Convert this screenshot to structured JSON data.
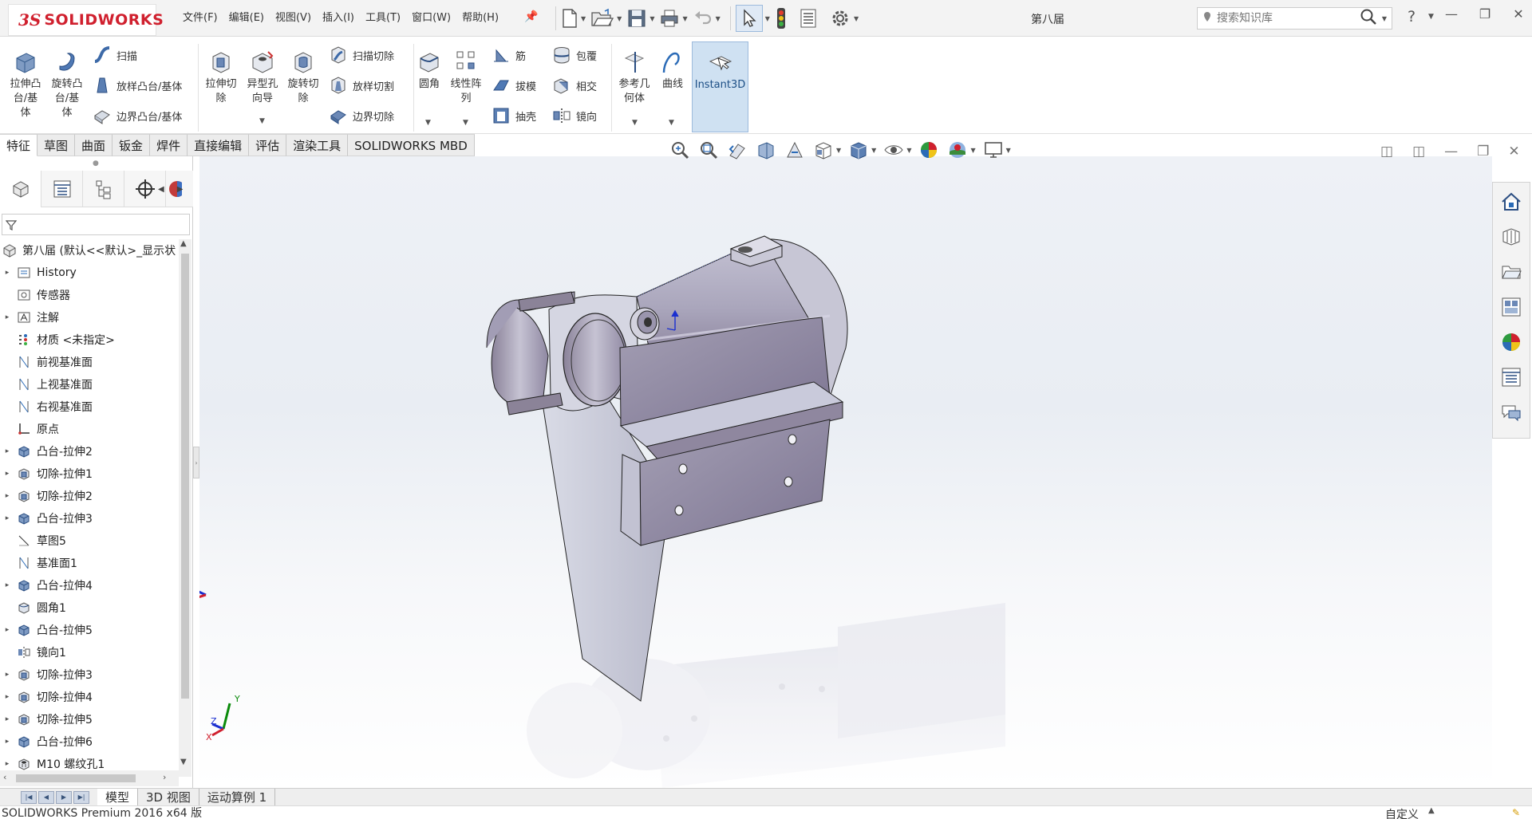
{
  "app": {
    "logo_ds": "3S",
    "logo_text": "SOLIDWORKS",
    "document_title": "第八届"
  },
  "menus": [
    "文件(F)",
    "编辑(E)",
    "视图(V)",
    "插入(I)",
    "工具(T)",
    "窗口(W)",
    "帮助(H)"
  ],
  "search": {
    "placeholder": "搜索知识库"
  },
  "ribbon": {
    "extrude_boss": "拉伸凸\n台/基\n体",
    "revolve_boss": "旋转凸\n台/基\n体",
    "sweep": "扫描",
    "loft_boss": "放样凸台/基体",
    "boundary_boss": "边界凸台/基体",
    "extrude_cut": "拉伸切\n除",
    "hole_wizard": "异型孔\n向导",
    "revolve_cut": "旋转切\n除",
    "sweep_cut": "扫描切除",
    "loft_cut": "放样切割",
    "boundary_cut": "边界切除",
    "fillet": "圆角",
    "linear_pattern": "线性阵\n列",
    "rib": "筋",
    "draft": "拔模",
    "shell": "抽壳",
    "wrap": "包覆",
    "intersect": "相交",
    "mirror": "镜向",
    "ref_geometry": "参考几\n何体",
    "curves": "曲线",
    "instant3d": "Instant3D"
  },
  "command_tabs": [
    "特征",
    "草图",
    "曲面",
    "钣金",
    "焊件",
    "直接编辑",
    "评估",
    "渲染工具",
    "SOLIDWORKS MBD"
  ],
  "tree": {
    "root": "第八届 (默认<<默认>_显示状",
    "items": [
      {
        "label": "History",
        "expand": true,
        "icon": "history-icon"
      },
      {
        "label": "传感器",
        "expand": false,
        "icon": "sensor-icon"
      },
      {
        "label": "注解",
        "expand": true,
        "icon": "annotation-icon"
      },
      {
        "label": "材质 <未指定>",
        "expand": false,
        "icon": "material-icon"
      },
      {
        "label": "前视基准面",
        "expand": false,
        "icon": "plane-icon"
      },
      {
        "label": "上视基准面",
        "expand": false,
        "icon": "plane-icon"
      },
      {
        "label": "右视基准面",
        "expand": false,
        "icon": "plane-icon"
      },
      {
        "label": "原点",
        "expand": false,
        "icon": "origin-icon"
      },
      {
        "label": "凸台-拉伸2",
        "expand": true,
        "icon": "extrude-feature-icon"
      },
      {
        "label": "切除-拉伸1",
        "expand": true,
        "icon": "cut-feature-icon"
      },
      {
        "label": "切除-拉伸2",
        "expand": true,
        "icon": "cut-feature-icon"
      },
      {
        "label": "凸台-拉伸3",
        "expand": true,
        "icon": "extrude-feature-icon"
      },
      {
        "label": "草图5",
        "expand": false,
        "icon": "sketch-icon"
      },
      {
        "label": "基准面1",
        "expand": false,
        "icon": "plane-icon"
      },
      {
        "label": "凸台-拉伸4",
        "expand": true,
        "icon": "extrude-feature-icon"
      },
      {
        "label": "圆角1",
        "expand": false,
        "icon": "fillet-feature-icon"
      },
      {
        "label": "凸台-拉伸5",
        "expand": true,
        "icon": "extrude-feature-icon"
      },
      {
        "label": "镜向1",
        "expand": false,
        "icon": "mirror-feature-icon"
      },
      {
        "label": "切除-拉伸3",
        "expand": true,
        "icon": "cut-feature-icon"
      },
      {
        "label": "切除-拉伸4",
        "expand": true,
        "icon": "cut-feature-icon"
      },
      {
        "label": "切除-拉伸5",
        "expand": true,
        "icon": "cut-feature-icon"
      },
      {
        "label": "凸台-拉伸6",
        "expand": true,
        "icon": "extrude-feature-icon"
      },
      {
        "label": "M10 螺纹孔1",
        "expand": true,
        "icon": "hole-feature-icon"
      }
    ]
  },
  "triad": {
    "x": "X",
    "y": "Y",
    "z": "Z"
  },
  "bottom_tabs": [
    "模型",
    "3D 视图",
    "运动算例 1"
  ],
  "status": {
    "left": "SOLIDWORKS Premium 2016 x64 版",
    "right": "自定义"
  },
  "colors": {
    "brand": "#d0202e",
    "part_face": "#8d86a2",
    "active_tab_highlight": "#cfe1f2"
  }
}
